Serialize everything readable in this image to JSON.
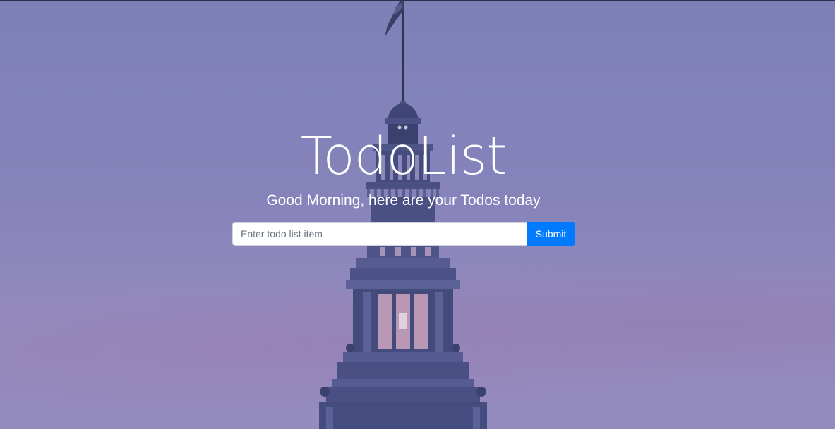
{
  "hero": {
    "title": "TodoList",
    "subtitle": "Good Morning, here are your Todos today"
  },
  "form": {
    "input_placeholder": "Enter todo list item",
    "input_value": "",
    "submit_label": "Submit"
  },
  "colors": {
    "overlay": "#8683bb",
    "tower": "#3f4577",
    "submit_button": "#007bff",
    "text": "#ffffff"
  }
}
